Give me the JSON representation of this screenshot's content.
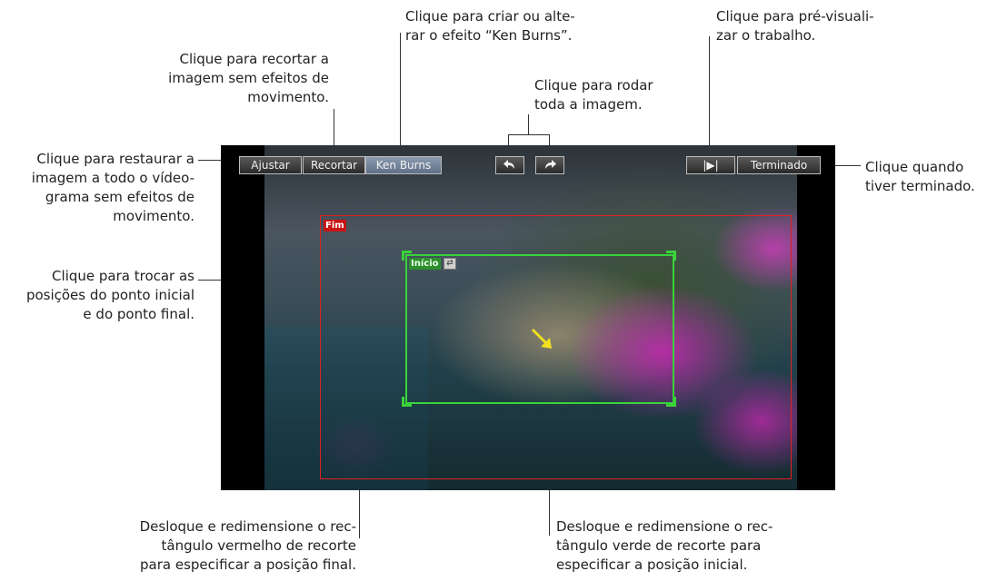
{
  "toolbar": {
    "ajustar_label": "Ajustar",
    "recortar_label": "Recortar",
    "ken_burns_label": "Ken Burns",
    "rotate_left_icon": "rotate-left-icon",
    "rotate_right_icon": "rotate-right-icon",
    "preview_label": "|▶|",
    "done_label": "Terminado"
  },
  "viewer": {
    "end_label": "Fim",
    "start_label": "Início",
    "swap_icon": "swap-icon",
    "red_color": "#e02020",
    "green_color": "#39d339"
  },
  "callouts": {
    "ajustar": "Clique para restaurar a\nimagem a todo o vídeo-\ngrama sem efeitos de\nmovimento.",
    "recortar": "Clique para recortar a\nimagem sem efeitos de\nmovimento.",
    "ken_burns": "Clique para criar ou alte-\nrar o efeito “Ken Burns”.",
    "rotate": "Clique para rodar\ntoda a imagem.",
    "preview": "Clique para pré-visuali-\nzar o trabalho.",
    "done": "Clique quando\ntiver terminado.",
    "swap": "Clique para trocar as\nposições do ponto inicial\ne do ponto final.",
    "red_rect": "Desloque e redimensione o rec-\ntângulo vermelho de recorte\npara especificar a posição final.",
    "green_rect": "Desloque e redimensione o rec-\ntângulo verde de recorte para\nespecificar a posição inicial."
  }
}
